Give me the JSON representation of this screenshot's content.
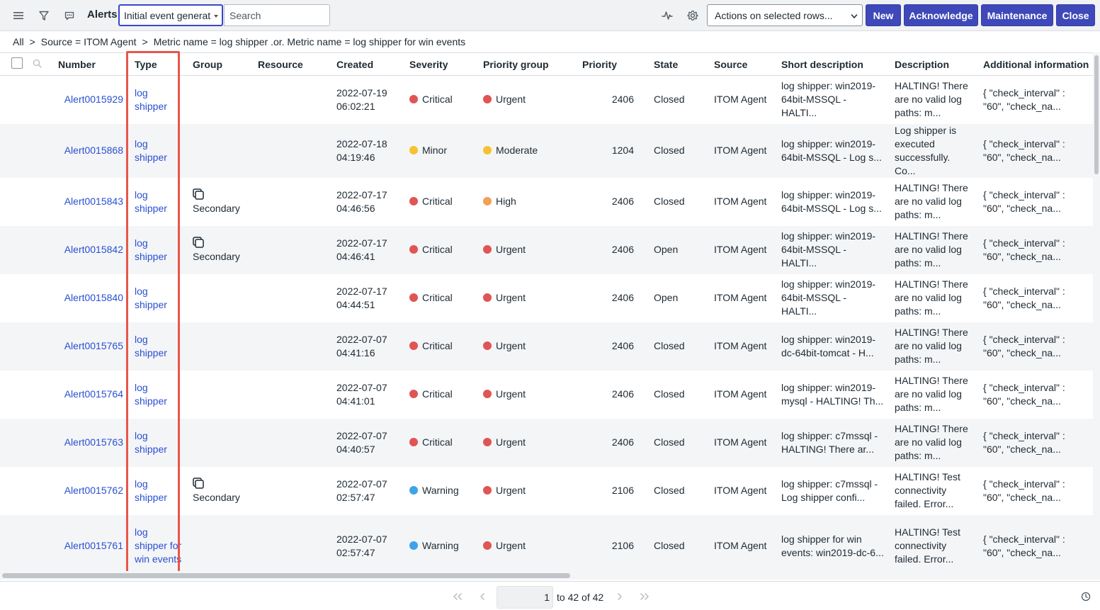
{
  "header": {
    "title": "Alerts",
    "field_select_value": "Initial event generat",
    "search_placeholder": "Search",
    "actions_select_value": "Actions on selected rows...",
    "buttons": {
      "new": "New",
      "acknowledge": "Acknowledge",
      "maintenance": "Maintenance",
      "close": "Close"
    }
  },
  "breadcrumb": {
    "items": [
      "All",
      "Source = ITOM Agent",
      "Metric name = log shipper .or. Metric name = log shipper for win events"
    ]
  },
  "columns": [
    "Number",
    "Type",
    "Group",
    "Resource",
    "Created",
    "Severity",
    "Priority group",
    "Priority",
    "State",
    "Source",
    "Short description",
    "Description",
    "Additional information"
  ],
  "rows": [
    {
      "number": "Alert0015929",
      "type": "log shipper",
      "group": "",
      "resource": "",
      "created_date": "2022-07-19",
      "created_time": "06:02:21",
      "severity": "Critical",
      "priority_group": "Urgent",
      "priority": "2406",
      "state": "Closed",
      "source": "ITOM Agent",
      "short_description": "log shipper: win2019-64bit-MSSQL - HALTI...",
      "description": "HALTING! There are no valid log paths: m...",
      "additional_information": "{ \"check_interval\" : \"60\", \"check_na..."
    },
    {
      "number": "Alert0015868",
      "type": "log shipper",
      "group": "",
      "resource": "",
      "created_date": "2022-07-18",
      "created_time": "04:19:46",
      "severity": "Minor",
      "priority_group": "Moderate",
      "priority": "1204",
      "state": "Closed",
      "source": "ITOM Agent",
      "short_description": "log shipper: win2019-64bit-MSSQL - Log s...",
      "description": "Log shipper is executed successfully. Co...",
      "additional_information": "{ \"check_interval\" : \"60\", \"check_na..."
    },
    {
      "number": "Alert0015843",
      "type": "log shipper",
      "group": "Secondary",
      "resource": "",
      "created_date": "2022-07-17",
      "created_time": "04:46:56",
      "severity": "Critical",
      "priority_group": "High",
      "priority": "2406",
      "state": "Closed",
      "source": "ITOM Agent",
      "short_description": "log shipper: win2019-64bit-MSSQL - Log s...",
      "description": "HALTING! There are no valid log paths: m...",
      "additional_information": "{ \"check_interval\" : \"60\", \"check_na..."
    },
    {
      "number": "Alert0015842",
      "type": "log shipper",
      "group": "Secondary",
      "resource": "",
      "created_date": "2022-07-17",
      "created_time": "04:46:41",
      "severity": "Critical",
      "priority_group": "Urgent",
      "priority": "2406",
      "state": "Open",
      "source": "ITOM Agent",
      "short_description": "log shipper: win2019-64bit-MSSQL - HALTI...",
      "description": "HALTING! There are no valid log paths: m...",
      "additional_information": "{ \"check_interval\" : \"60\", \"check_na..."
    },
    {
      "number": "Alert0015840",
      "type": "log shipper",
      "group": "",
      "resource": "",
      "created_date": "2022-07-17",
      "created_time": "04:44:51",
      "severity": "Critical",
      "priority_group": "Urgent",
      "priority": "2406",
      "state": "Open",
      "source": "ITOM Agent",
      "short_description": "log shipper: win2019-64bit-MSSQL - HALTI...",
      "description": "HALTING! There are no valid log paths: m...",
      "additional_information": "{ \"check_interval\" : \"60\", \"check_na..."
    },
    {
      "number": "Alert0015765",
      "type": "log shipper",
      "group": "",
      "resource": "",
      "created_date": "2022-07-07",
      "created_time": "04:41:16",
      "severity": "Critical",
      "priority_group": "Urgent",
      "priority": "2406",
      "state": "Closed",
      "source": "ITOM Agent",
      "short_description": "log shipper: win2019-dc-64bit-tomcat - H...",
      "description": "HALTING! There are no valid log paths: m...",
      "additional_information": "{ \"check_interval\" : \"60\", \"check_na..."
    },
    {
      "number": "Alert0015764",
      "type": "log shipper",
      "group": "",
      "resource": "",
      "created_date": "2022-07-07",
      "created_time": "04:41:01",
      "severity": "Critical",
      "priority_group": "Urgent",
      "priority": "2406",
      "state": "Closed",
      "source": "ITOM Agent",
      "short_description": "log shipper: win2019-mysql - HALTING! Th...",
      "description": "HALTING! There are no valid log paths: m...",
      "additional_information": "{ \"check_interval\" : \"60\", \"check_na..."
    },
    {
      "number": "Alert0015763",
      "type": "log shipper",
      "group": "",
      "resource": "",
      "created_date": "2022-07-07",
      "created_time": "04:40:57",
      "severity": "Critical",
      "priority_group": "Urgent",
      "priority": "2406",
      "state": "Closed",
      "source": "ITOM Agent",
      "short_description": "log shipper: c7mssql - HALTING! There ar...",
      "description": "HALTING! There are no valid log paths: m...",
      "additional_information": "{ \"check_interval\" : \"60\", \"check_na..."
    },
    {
      "number": "Alert0015762",
      "type": "log shipper",
      "group": "Secondary",
      "resource": "",
      "created_date": "2022-07-07",
      "created_time": "02:57:47",
      "severity": "Warning",
      "priority_group": "Urgent",
      "priority": "2106",
      "state": "Closed",
      "source": "ITOM Agent",
      "short_description": "log shipper: c7mssql - Log shipper confi...",
      "description": "HALTING! Test connectivity failed. Error...",
      "additional_information": "{ \"check_interval\" : \"60\", \"check_na..."
    },
    {
      "number": "Alert0015761",
      "type": "log shipper for win events",
      "group": "",
      "resource": "",
      "created_date": "2022-07-07",
      "created_time": "02:57:47",
      "severity": "Warning",
      "priority_group": "Urgent",
      "priority": "2106",
      "state": "Closed",
      "source": "ITOM Agent",
      "short_description": "log shipper for win events: win2019-dc-6...",
      "description": "HALTING! Test connectivity failed. Error...",
      "additional_information": "{ \"check_interval\" : \"60\", \"check_na..."
    }
  ],
  "pagination": {
    "current_page": "1",
    "range_text": "to 42 of 42"
  },
  "colors": {
    "accent": "#3e48b8",
    "link": "#2a4fd1",
    "highlight": "#e8564a",
    "critical": "#e05454",
    "minor": "#f5c232",
    "warning": "#3fa3ea",
    "high": "#f2a154"
  },
  "icons": {
    "menu": "hamburger-icon",
    "filter": "funnel-icon",
    "chat": "speech-bubble-icon",
    "activity": "pulse-icon",
    "settings": "gear-icon",
    "column_search": "magnifier-icon",
    "group": "group-stack-icon",
    "first_page": "double-chevron-left-icon",
    "prev_page": "chevron-left-icon",
    "next_page": "chevron-right-icon",
    "last_page": "double-chevron-right-icon",
    "info": "clock-info-icon"
  }
}
